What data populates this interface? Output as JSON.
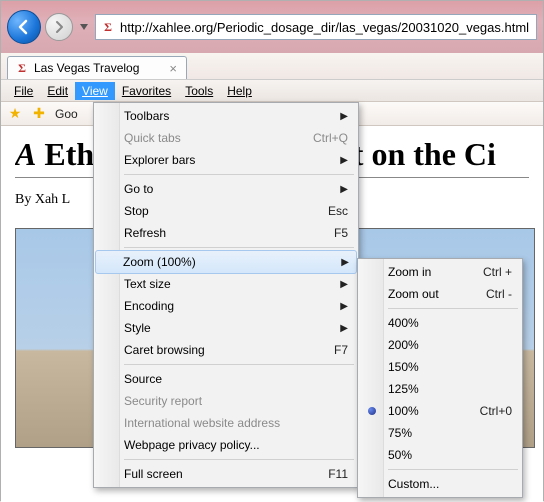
{
  "nav": {
    "url": "http://xahlee.org/Periodic_dosage_dir/las_vegas/20031020_vegas.html",
    "site_icon_glyph": "Σ"
  },
  "tab": {
    "icon_glyph": "Σ",
    "title": "Las Vegas Travelog"
  },
  "menubar": {
    "file": "File",
    "edit": "Edit",
    "view": "View",
    "favorites": "Favorites",
    "tools": "Tools",
    "help": "Help"
  },
  "favbar": {
    "item1": "Goo"
  },
  "page": {
    "heading_prefix_italic": "A",
    "heading_rest": " Ethnographer's Report on the Ci",
    "byline": "By Xah L"
  },
  "viewmenu": {
    "toolbars": "Toolbars",
    "quicktabs": "Quick tabs",
    "quicktabs_sc": "Ctrl+Q",
    "explorerbars": "Explorer bars",
    "goto": "Go to",
    "stop": "Stop",
    "stop_sc": "Esc",
    "refresh": "Refresh",
    "refresh_sc": "F5",
    "zoom": "Zoom (100%)",
    "textsize": "Text size",
    "encoding": "Encoding",
    "style": "Style",
    "caret": "Caret browsing",
    "caret_sc": "F7",
    "source": "Source",
    "security": "Security report",
    "intl": "International website address",
    "privacy": "Webpage privacy policy...",
    "fullscreen": "Full screen",
    "fullscreen_sc": "F11"
  },
  "zoommenu": {
    "zoomin": "Zoom in",
    "zoomin_sc": "Ctrl +",
    "zoomout": "Zoom out",
    "zoomout_sc": "Ctrl -",
    "p400": "400%",
    "p200": "200%",
    "p150": "150%",
    "p125": "125%",
    "p100": "100%",
    "p100_sc": "Ctrl+0",
    "p75": "75%",
    "p50": "50%",
    "custom": "Custom..."
  }
}
